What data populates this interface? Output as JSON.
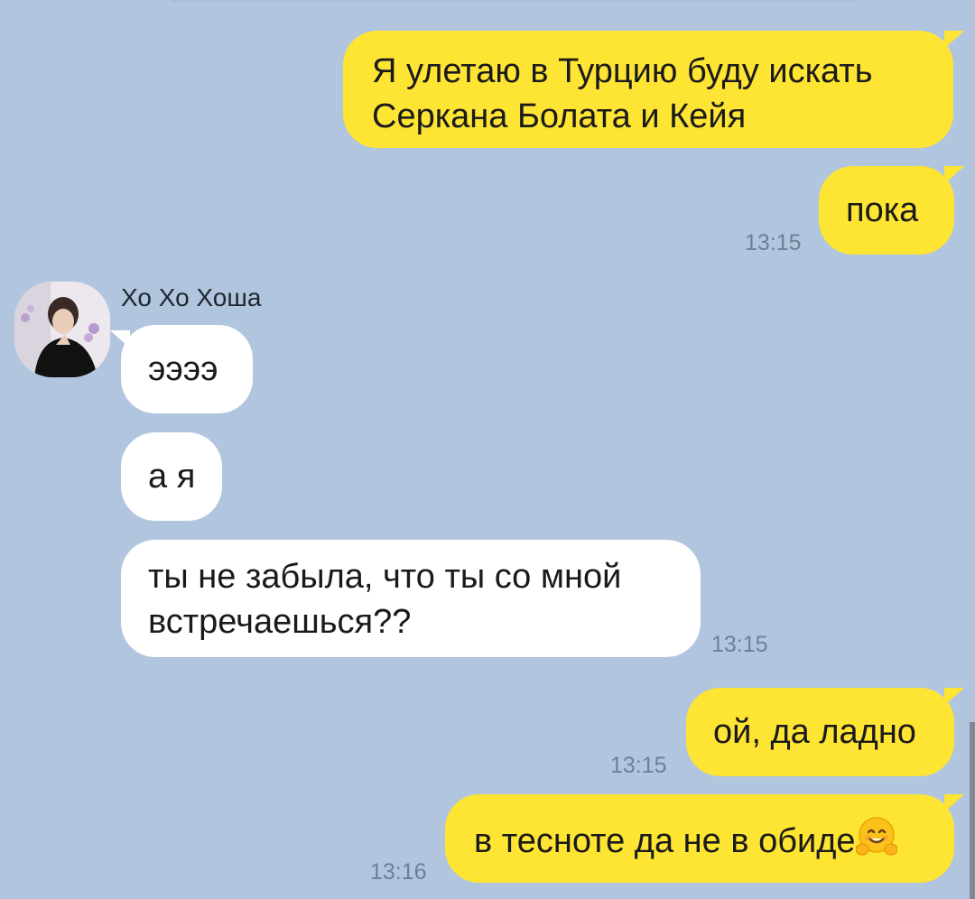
{
  "chat": {
    "contact_name": "Хо Хо Хоша",
    "messages": [
      {
        "side": "out",
        "text_line1": "Я  улетаю в Турцию буду искать",
        "text_line2": "Серкана Болата и Кейя"
      },
      {
        "side": "out",
        "text": "пока",
        "time": "13:15"
      },
      {
        "side": "in",
        "text": "ээээ"
      },
      {
        "side": "in",
        "text": "а я"
      },
      {
        "side": "in",
        "text_line1": "ты не забыла, что ты со мной",
        "text_line2": "встречаешься??",
        "time": "13:15"
      },
      {
        "side": "out",
        "text": "ой, да ладно",
        "time": "13:15"
      },
      {
        "side": "out",
        "text": "в тесноте да не в обиде",
        "emoji": "hugging-face",
        "time": "13:16"
      }
    ]
  },
  "colors": {
    "background": "#b1c6de",
    "outgoing_bubble": "#fee433",
    "incoming_bubble": "#ffffff",
    "timestamp": "#6e7f96"
  }
}
